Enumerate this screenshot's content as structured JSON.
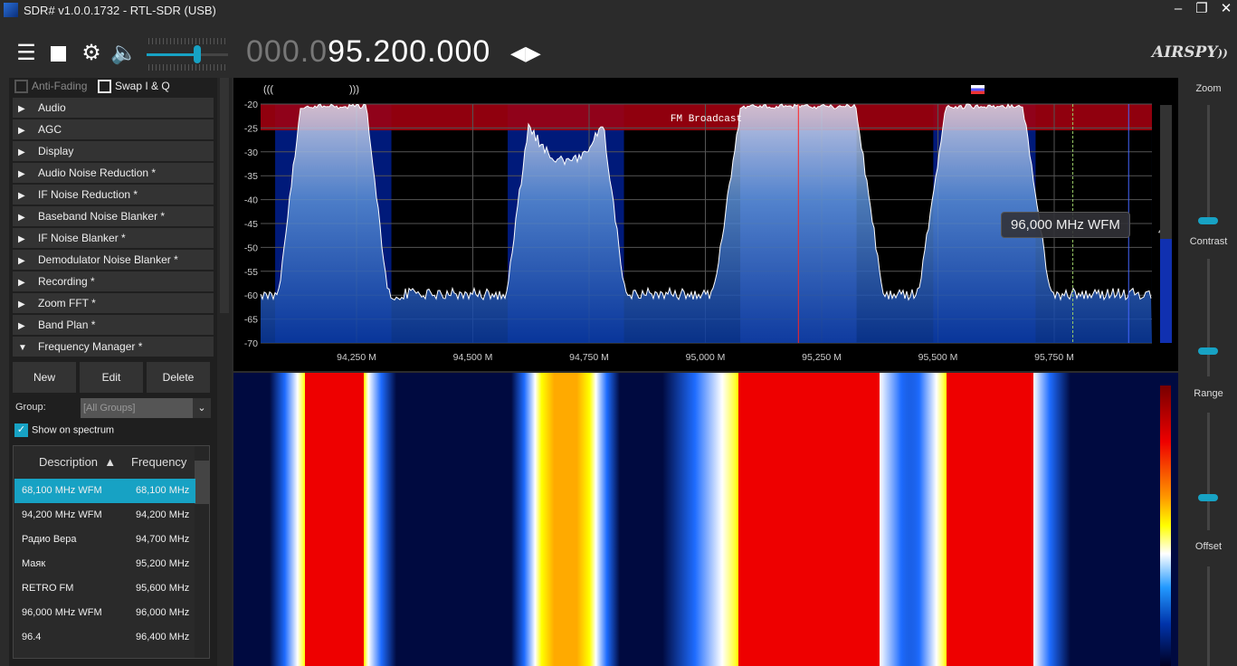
{
  "window": {
    "title": "SDR# v1.0.0.1732 - RTL-SDR (USB)",
    "minimize": "–",
    "maximize": "❐",
    "close": "✕"
  },
  "toolbar": {
    "menu_icon": "hamburger-icon",
    "stop_icon": "stop-icon",
    "settings_icon": "gear-icon",
    "audio_icon": "speaker-icon",
    "volume": 0.62,
    "freq_dim": "000.0",
    "freq_main": "95.200.000",
    "tuning_icon": "left-right-arrows-icon",
    "logo": "AIRSPY"
  },
  "left": {
    "anti_fading": "Anti-Fading",
    "swap_iq": "Swap I & Q",
    "sections": [
      "Audio",
      "AGC",
      "Display",
      "Audio Noise Reduction *",
      "IF Noise Reduction *",
      "Baseband Noise Blanker *",
      "IF Noise Blanker *",
      "Demodulator Noise Blanker *",
      "Recording *",
      "Zoom FFT *",
      "Band Plan *",
      "Frequency Manager *"
    ],
    "buttons": {
      "new": "New",
      "edit": "Edit",
      "delete": "Delete"
    },
    "group_label": "Group:",
    "group_value": "[All Groups]",
    "show_on_spectrum": "Show on spectrum",
    "columns": {
      "description": "Description",
      "frequency": "Frequency"
    },
    "rows": [
      {
        "description": "68,100 MHz WFM",
        "frequency": "68,100 MHz"
      },
      {
        "description": "94,200 MHz WFM",
        "frequency": "94,200 MHz"
      },
      {
        "description": "Радио Вера",
        "frequency": "94,700 MHz"
      },
      {
        "description": "Маяк",
        "frequency": "95,200 MHz"
      },
      {
        "description": "RETRO FM",
        "frequency": "95,600 MHz"
      },
      {
        "description": "96,000 MHz WFM",
        "frequency": "96,000 MHz"
      },
      {
        "description": "96.4",
        "frequency": "96,400 MHz"
      }
    ]
  },
  "spectrum": {
    "stereo_left": "(((",
    "stereo_right": ")))",
    "band_label": "FM Broadcast",
    "y_ticks": [
      "-20",
      "-25",
      "-30",
      "-35",
      "-40",
      "-45",
      "-50",
      "-55",
      "-60",
      "-65",
      "-70"
    ],
    "x_ticks": [
      "94,250 M",
      "94,500 M",
      "94,750 M",
      "95,000 M",
      "95,250 M",
      "95,500 M",
      "95,750 M"
    ],
    "tooltip": "96,000 MHz WFM",
    "snr": "43",
    "center_khz": 95200,
    "stations_khz": [
      94200,
      94700,
      95200,
      95600
    ]
  },
  "right": {
    "zoom": "Zoom",
    "contrast": "Contrast",
    "range": "Range",
    "offset": "Offset"
  },
  "colors": {
    "accent": "#17a2c4",
    "band": "#a00010",
    "selection": "#17a2c4"
  }
}
